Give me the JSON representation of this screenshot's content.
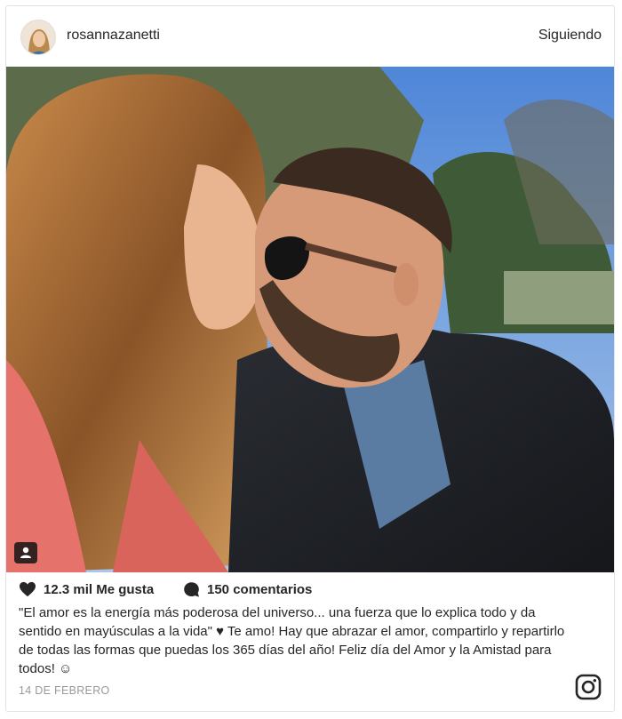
{
  "post": {
    "username": "rosannazanetti",
    "follow_label": "Siguiendo",
    "likes_label": "12.3 mil Me gusta",
    "comments_label": "150 comentarios",
    "caption": "\"El amor es la energía más poderosa del universo... una fuerza que lo explica todo y da sentido en mayúsculas a la vida\" ♥ Te amo! Hay que abrazar el amor, compartirlo y repartirlo de todas las formas que puedas los 365 días del año! Feliz día del Amor y la Amistad para todos! ☺",
    "date": "14 DE FEBRERO"
  },
  "icons": {
    "like": "heart-icon",
    "comment": "comment-bubble-icon",
    "tagged": "tagged-user-icon",
    "brand": "instagram-logo-icon"
  },
  "colors": {
    "text": "#262626",
    "muted": "#999999",
    "border": "#e3e3e3",
    "sky": "#7aa1d6"
  }
}
